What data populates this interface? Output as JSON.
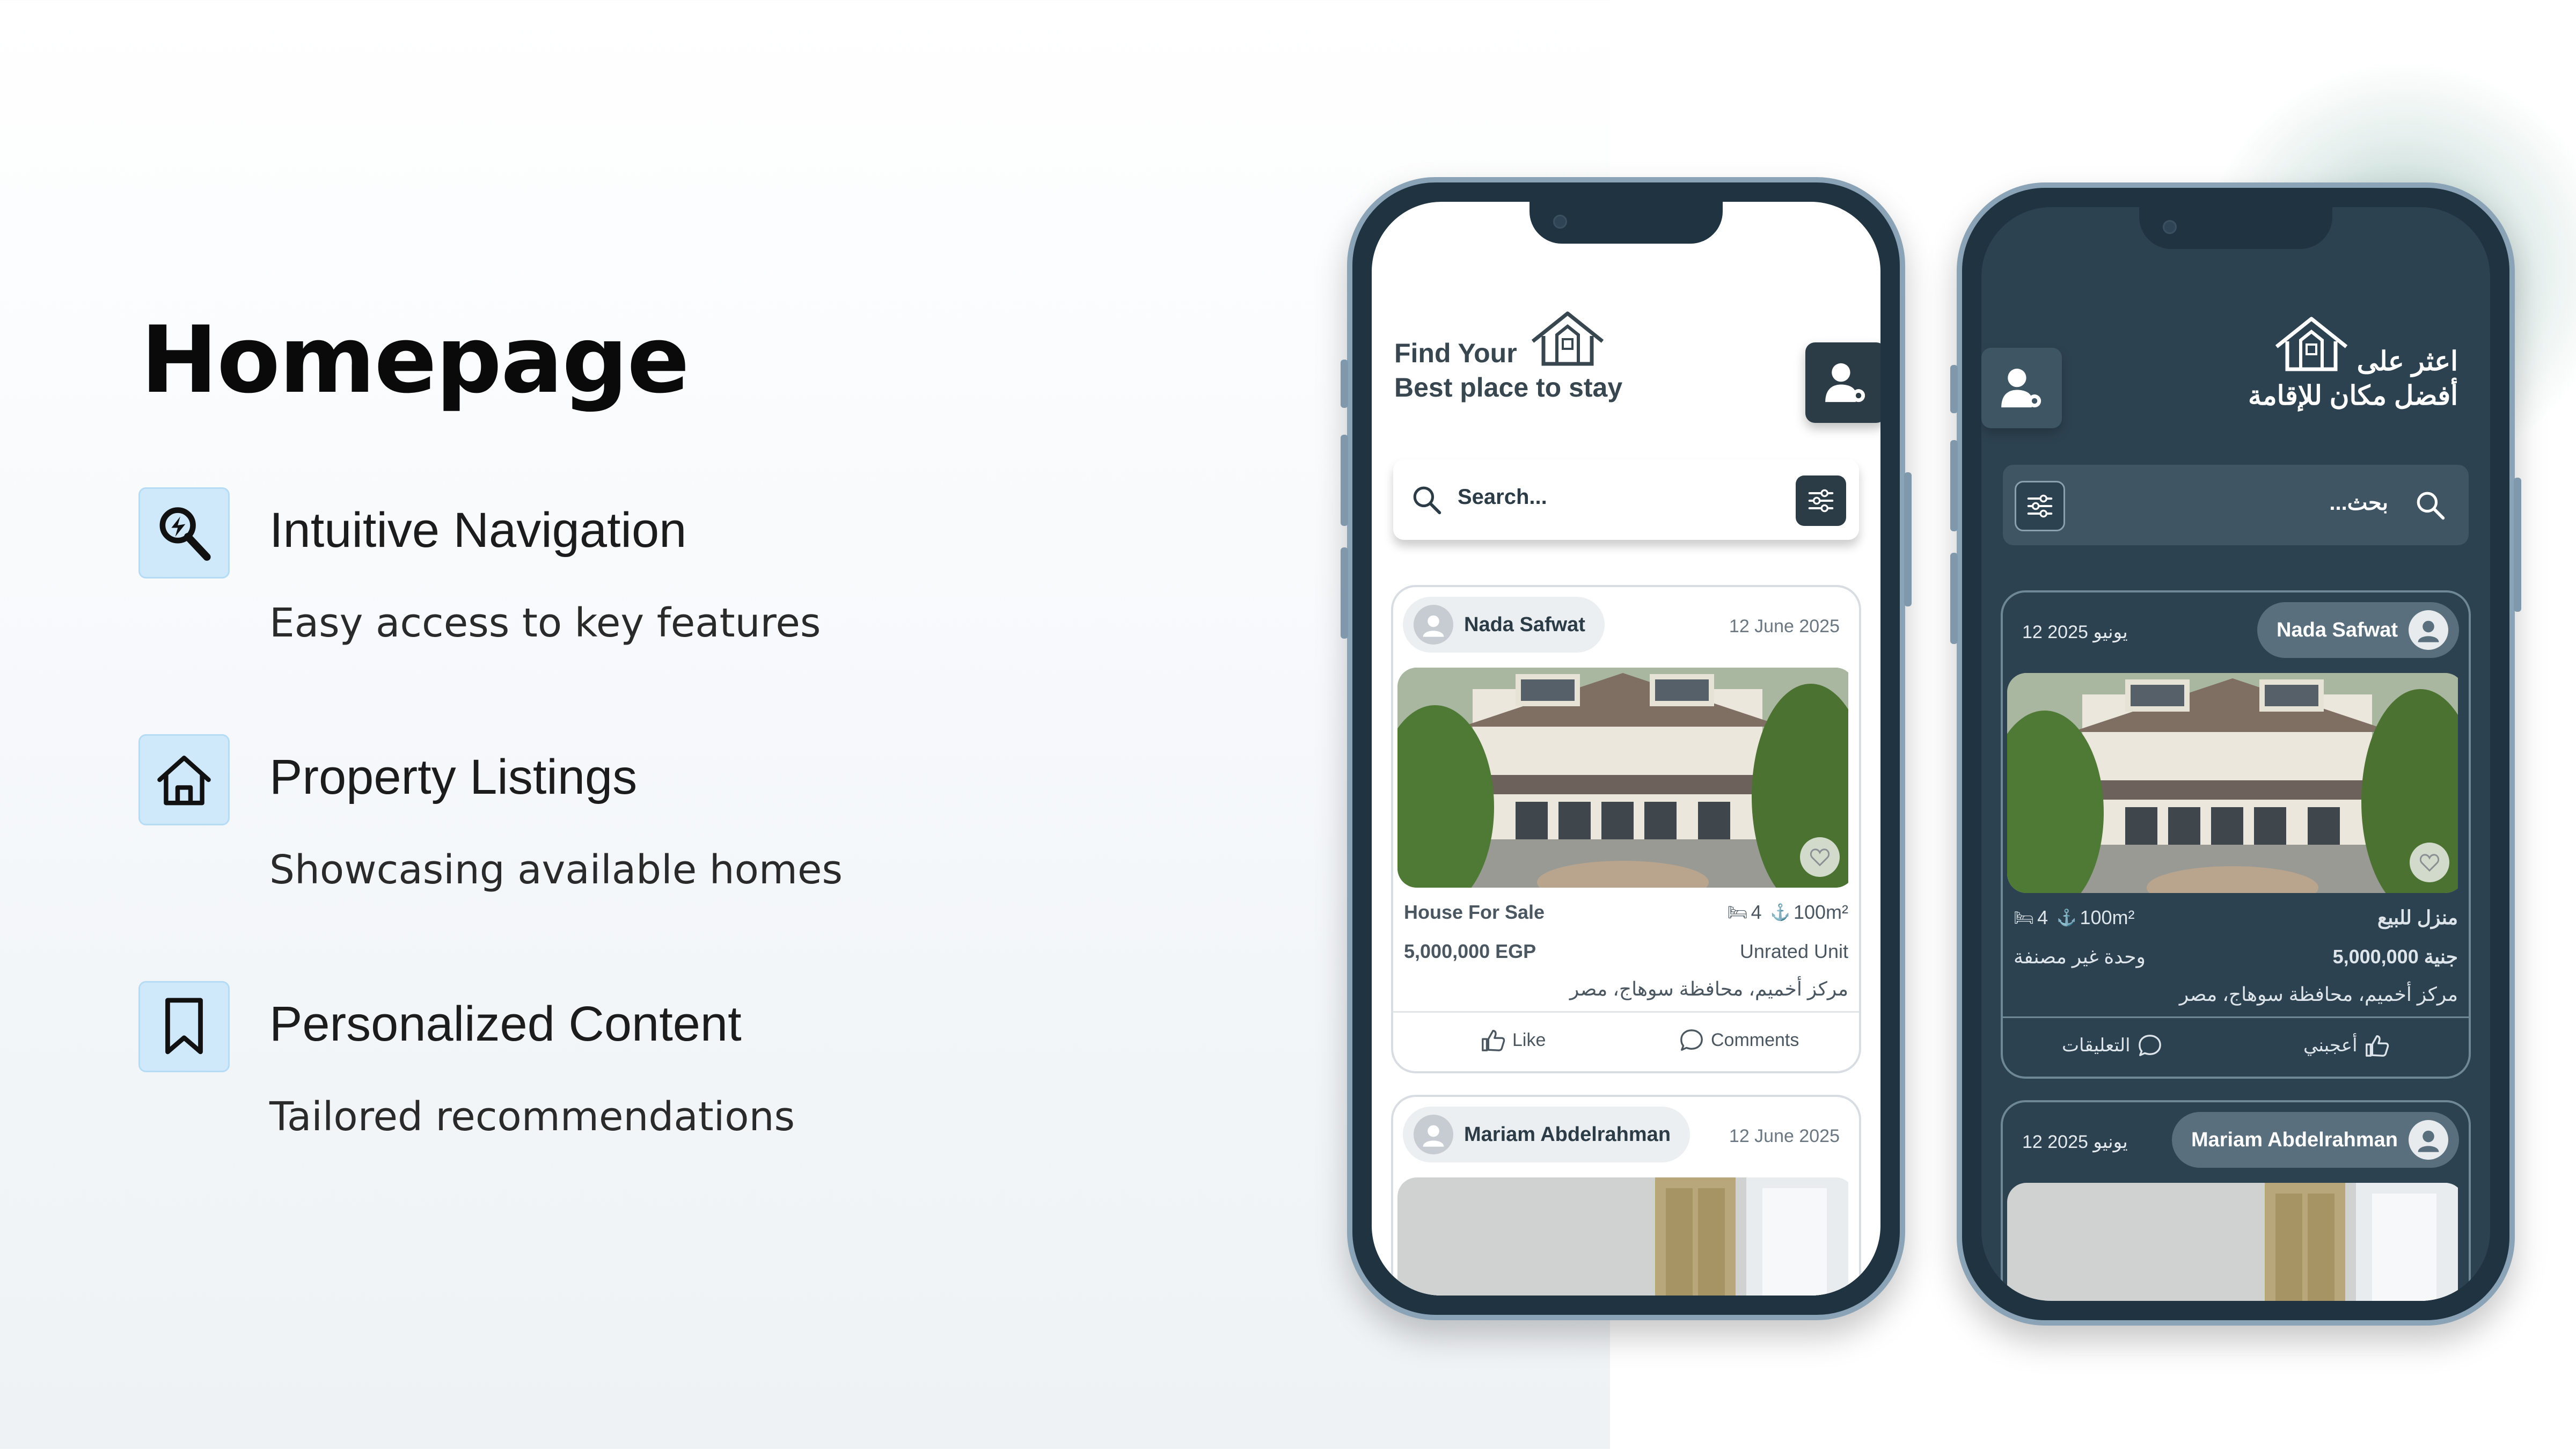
{
  "slide": {
    "title": "Homepage",
    "features": [
      {
        "icon": "magnifier-icon",
        "title": "Intuitive Navigation",
        "description": "Easy access to key features"
      },
      {
        "icon": "home-icon",
        "title": "Property Listings",
        "description": "Showcasing available homes"
      },
      {
        "icon": "bookmark-icon",
        "title": "Personalized Content",
        "description": "Tailored recommendations"
      }
    ]
  },
  "phone_en": {
    "header_line1": "Find Your",
    "header_line2": "Best place to stay",
    "search_placeholder": "Search...",
    "cards": [
      {
        "user": "Nada Safwat",
        "date": "12 June 2025",
        "type": "House For Sale",
        "rooms": "4",
        "area": "100m²",
        "price": "5,000,000 EGP",
        "status": "Unrated Unit",
        "location": "مركز أخميم، محافظة سوهاج، مصر",
        "like_label": "Like",
        "comments_label": "Comments"
      },
      {
        "user": "Mariam Abdelrahman",
        "date": "12 June 2025"
      }
    ]
  },
  "phone_ar": {
    "header_line1": "اعثر على",
    "header_line2": "أفضل مكان للإقامة",
    "search_placeholder": "...بحث",
    "cards": [
      {
        "user": "Nada Safwat",
        "date": "12 يونيو 2025",
        "type": "منزل للبيع",
        "rooms": "4",
        "area": "100m²",
        "price": "5,000,000 جنية",
        "status": "وحدة غير مصنفة",
        "location": "مركز أخميم، محافظة سوهاج، مصر",
        "like_label": "أعجبني",
        "comments_label": "التعليقات"
      },
      {
        "user": "Mariam Abdelrahman",
        "date": "12 يونيو 2025"
      }
    ]
  },
  "colors": {
    "accent_light_blue": "#cfe9fb",
    "dark_slate": "#2c3c47",
    "dark_screen": "#2d4250",
    "phone_frame": "#8aa3b6"
  }
}
